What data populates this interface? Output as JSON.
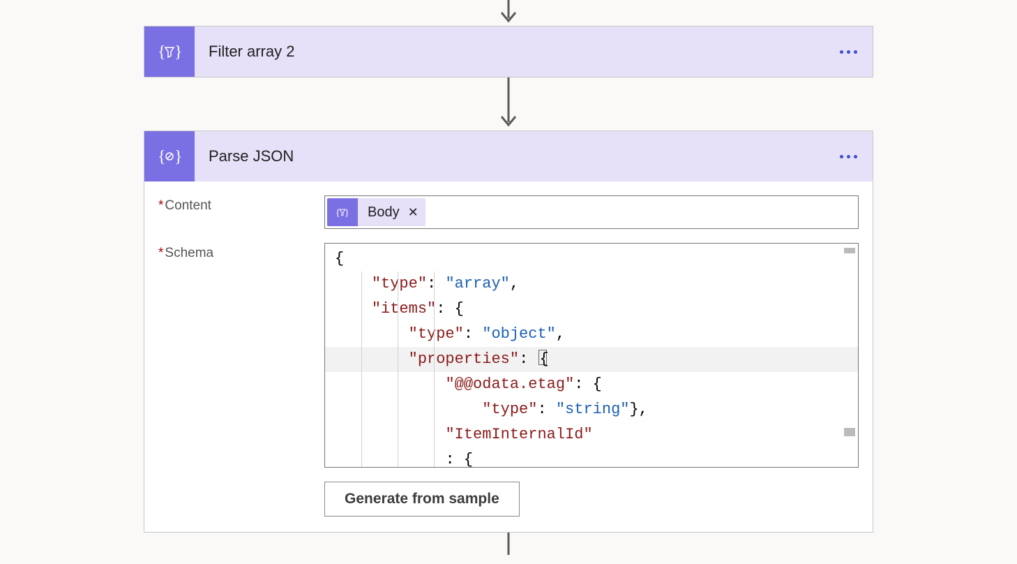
{
  "steps": {
    "filterArray": {
      "title": "Filter array 2"
    },
    "parseJson": {
      "title": "Parse JSON",
      "fields": {
        "content": {
          "label": "Content",
          "token": {
            "label": "Body"
          }
        },
        "schema": {
          "label": "Schema",
          "json": {
            "type": "array",
            "items": {
              "type": "object",
              "properties": {
                "@@odata.etag": {
                  "type": "string"
                },
                "ItemInternalId": {}
              }
            }
          },
          "tokens": [
            {
              "t": "punc",
              "v": "{"
            },
            {
              "t": "key",
              "v": "\"type\""
            },
            {
              "t": "punc",
              "v": ": "
            },
            {
              "t": "str",
              "v": "\"array\""
            },
            {
              "t": "punc",
              "v": ","
            },
            {
              "t": "key",
              "v": "\"items\""
            },
            {
              "t": "punc",
              "v": ": {"
            },
            {
              "t": "key",
              "v": "\"type\""
            },
            {
              "t": "punc",
              "v": ": "
            },
            {
              "t": "str",
              "v": "\"object\""
            },
            {
              "t": "punc",
              "v": ","
            },
            {
              "t": "key",
              "v": "\"properties\""
            },
            {
              "t": "punc",
              "v": ": {"
            },
            {
              "t": "key",
              "v": "\"@@odata.etag\""
            },
            {
              "t": "punc",
              "v": ": {"
            },
            {
              "t": "key",
              "v": "\"type\""
            },
            {
              "t": "punc",
              "v": ": "
            },
            {
              "t": "str",
              "v": "\"string\""
            },
            {
              "t": "punc",
              "v": "},"
            },
            {
              "t": "key",
              "v": "\"ItemInternalId\""
            },
            {
              "t": "punc",
              "v": ": {"
            }
          ]
        }
      },
      "generateButton": "Generate from sample"
    }
  }
}
